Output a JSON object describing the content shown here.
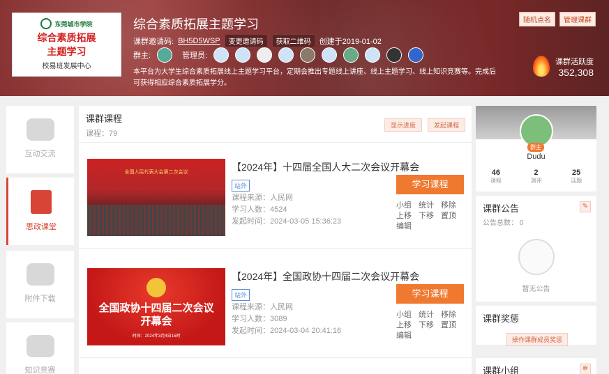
{
  "header": {
    "logo_school": "东莞城市学院",
    "logo_title_line1": "综合素质拓展",
    "logo_title_line2": "主题学习",
    "logo_center": "校易班发展中心",
    "title": "综合素质拓展主题学习",
    "invite_label": "课群邀请码:",
    "invite_code": "BH5D5WSP",
    "change_code": "变更邀请码",
    "get_qr": "获取二维码",
    "created": "创建于2019-01-02",
    "owner_label": "群主:",
    "admin_label": "管理员:",
    "description": "本平台为大学生综合素质拓展线上主题学习平台，定期会推出专题线上讲座、线上主题学习、线上知识竞赛等。完成后可获得相应综合素质拓展学分。",
    "random_call": "随机点名",
    "manage": "管理课群",
    "activity_label": "课群活跃度",
    "activity_value": "352,308"
  },
  "nav": [
    {
      "label": "互动交流"
    },
    {
      "label": "思政课堂"
    },
    {
      "label": "附件下载"
    },
    {
      "label": "知识竞赛"
    }
  ],
  "main": {
    "title": "课群课程",
    "count": "课程：79",
    "show_progress": "显示进度",
    "start_course": "发起课程",
    "items": [
      {
        "title": "【2024年】十四届全国人大二次会议开幕会",
        "tag": "站外",
        "source": "课程来源：人民网",
        "learners": "学习人数：4524",
        "time": "发起时间：2024-03-05 15:36:23",
        "study": "学习课程",
        "thumb_text": "全国人民代表大会第二次会议"
      },
      {
        "title": "【2024年】全国政协十四届二次会议开幕会",
        "tag": "站外",
        "source": "课程来源：人民网",
        "learners": "学习人数：3089",
        "time": "发起时间：2024-03-04 20:41:16",
        "study": "学习课程",
        "thumb_text1": "全国政协十四届二次会议",
        "thumb_text2": "开幕会",
        "thumb_date": "时间：2024年3月4日15时"
      }
    ],
    "ops": [
      "小组",
      "统计",
      "移除",
      "上移",
      "下移",
      "置顶",
      "编辑"
    ]
  },
  "profile": {
    "name": "Dudu",
    "badge": "群主",
    "stats": [
      {
        "v": "46",
        "l": "课程"
      },
      {
        "v": "2",
        "l": "测评"
      },
      {
        "v": "25",
        "l": "话题"
      }
    ]
  },
  "notice": {
    "title": "课群公告",
    "sub": "公告总数： 0",
    "empty": "暂无公告"
  },
  "award": {
    "title": "课群奖惩",
    "btn": "操作课群成员奖惩"
  },
  "group": {
    "title": "课群小组"
  },
  "colors": {
    "accent": "#f07930",
    "nav_active": "#d84435"
  }
}
